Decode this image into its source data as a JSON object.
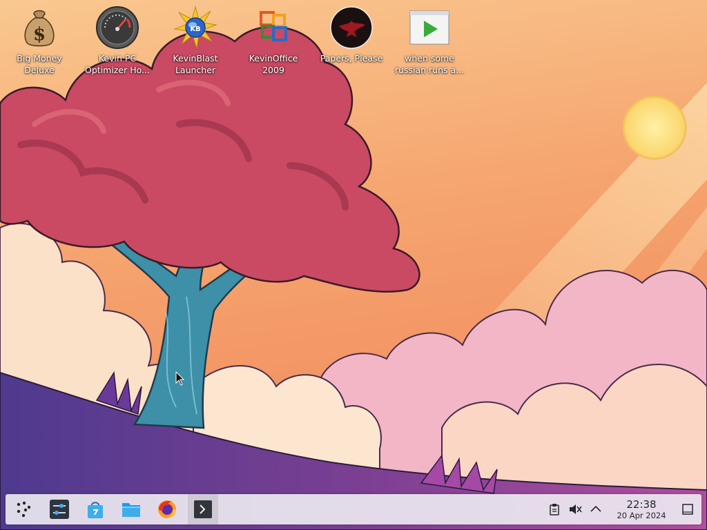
{
  "desktop": {
    "icons": [
      {
        "id": "big-money-deluxe",
        "line1": "Big Money",
        "line2": "Deluxe",
        "icon": "money-bag-icon"
      },
      {
        "id": "kevin-pc-optimizer",
        "line1": "Kevin PC",
        "line2": "Optimizer Ho...",
        "icon": "speedometer-icon"
      },
      {
        "id": "kevinblast-launcher",
        "line1": "KevinBlast",
        "line2": "Launcher",
        "icon": "burst-globe-icon"
      },
      {
        "id": "kevinoffice-2009",
        "line1": "KevinOffice",
        "line2": "2009",
        "icon": "office-logo-icon"
      },
      {
        "id": "papers-please",
        "line1": "Papers, Please",
        "line2": "",
        "icon": "eagle-emblem-icon"
      },
      {
        "id": "russian-video",
        "line1": "when some",
        "line2": "russian runs a...",
        "icon": "video-play-icon"
      }
    ]
  },
  "taskbar": {
    "launcher_icon": "app-launcher-icon",
    "pinned": [
      {
        "id": "system-settings",
        "icon": "settings-sliders-icon"
      },
      {
        "id": "discover",
        "icon": "shopping-bag-icon"
      },
      {
        "id": "dolphin",
        "icon": "folder-icon"
      },
      {
        "id": "firefox",
        "icon": "firefox-icon"
      },
      {
        "id": "konsole",
        "icon": "terminal-icon",
        "active": true
      }
    ],
    "tray": {
      "clipboard_icon": "clipboard-icon",
      "volume_icon": "volume-muted-icon",
      "expand_icon": "chevron-up-icon",
      "show_desktop_icon": "show-desktop-icon"
    },
    "clock": {
      "time": "22:38",
      "date": "20 Apr 2024"
    }
  },
  "colors": {
    "sky_top": "#f9c58c",
    "sky_bottom": "#f48a5a",
    "tree_foliage": "#c9405a",
    "tree_trunk": "#3c8fa6",
    "cloud": "#fbd9c0",
    "cloud_pink": "#f3b3c8",
    "hill": "#5b3b8e",
    "sun": "#fde28a",
    "taskbar": "#ece8f0"
  }
}
